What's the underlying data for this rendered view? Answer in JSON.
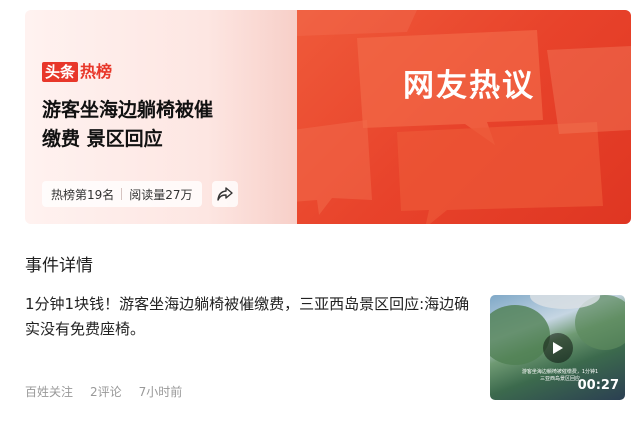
{
  "banner": {
    "logo_box": "头条",
    "logo_text": "热榜",
    "headline_line1": "游客坐海边躺椅被催",
    "headline_line2": "缴费 景区回应",
    "rank": "热榜第19名",
    "reads": "阅读量27万",
    "tag": "网友热议"
  },
  "event": {
    "section_title": "事件详情",
    "summary": "1分钟1块钱！游客坐海边躺椅被催缴费，三亚西岛景区回应:海边确实没有免费座椅。",
    "source": "百姓关注",
    "comments": "2评论",
    "time": "7小时前",
    "video": {
      "overlay_line1": "游客坐海边躺椅被催缴费，1分钟1",
      "overlay_line2": "三亚西岛景区回应",
      "duration": "00:27"
    }
  },
  "colors": {
    "brand_red": "#e8372a",
    "banner_right": "#e8432b"
  },
  "icons": [
    "share-icon",
    "play-icon"
  ]
}
